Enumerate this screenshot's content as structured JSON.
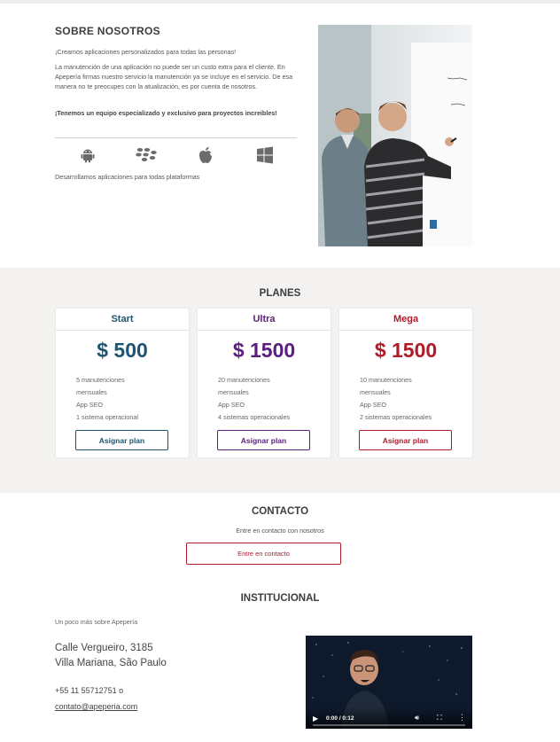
{
  "about": {
    "title": "SOBRE NOSOTROS",
    "tagline": "¡Creamos aplicaciones personalizados para todas las personas!",
    "body": "La manutención de una aplicación no puede ser un custo extra para el cliente. En Apepería firmas nuestro servicio la manutención ya se incluye en el servicio. De esa manera no te preocupes con la atualización, es por cuenta de nosotros.",
    "highlight": "¡Tenemos un equipo especializado y exclusivo para proyectos increibles!",
    "platforms": [
      "android-icon",
      "blackberry-icon",
      "apple-icon",
      "windows-icon"
    ],
    "platforms_caption": "Desarrollamos aplicaciones para todas plataformas"
  },
  "plans": {
    "title": "PLANES",
    "items": [
      {
        "name": "Start",
        "price": "$ 500",
        "features": [
          "5 manutenciones mensuales",
          "App SEO",
          "1 sistema operacional"
        ],
        "button": "Asignar plan",
        "color": "#1e5472"
      },
      {
        "name": "Ultra",
        "price": "$ 1500",
        "features": [
          "20 manutenciones mensuales",
          "App SEO",
          "4 sistemas operacionales"
        ],
        "button": "Asignar plan",
        "color": "#5b1d7e"
      },
      {
        "name": "Mega",
        "price": "$ 1500",
        "features": [
          "10 manutenciones mensuales",
          "App SEO",
          "2 sistemas operacionales"
        ],
        "button": "Asignar plan",
        "color": "#b01b2a"
      }
    ]
  },
  "contact": {
    "title": "CONTACTO",
    "subtitle": "Entre en contacto con nosotros",
    "button": "Entre en contacto"
  },
  "institutional": {
    "title": "INSTITUCIONAL",
    "subtitle": "Un poco más sobre Apepería",
    "address_line1": "Calle Vergueiro, 3185",
    "address_line2": "Villa Mariana, São Paulo",
    "phone": "+55 11 55712751 o",
    "email": "contato@apeperia.com",
    "video": {
      "time": "0:00 / 0:12",
      "progress": 0
    }
  }
}
